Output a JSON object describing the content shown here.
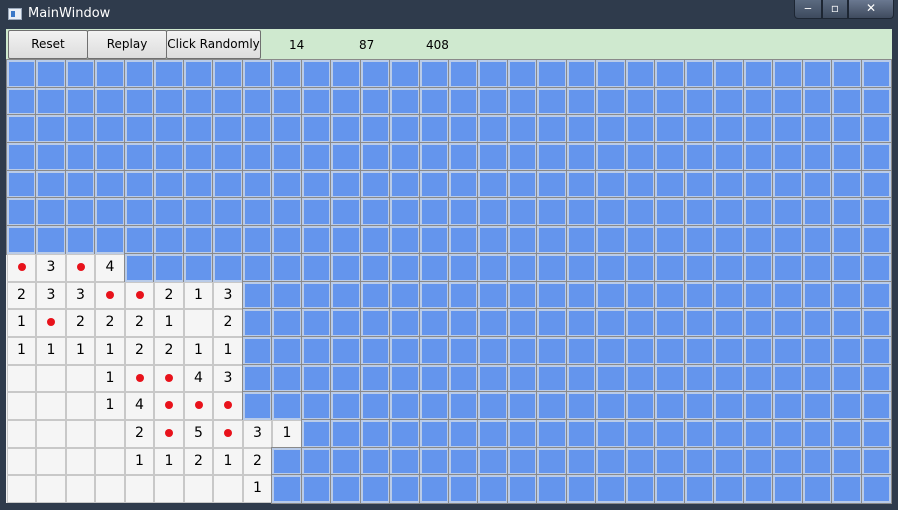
{
  "window": {
    "title": "MainWindow"
  },
  "toolbar": {
    "reset_label": "Reset",
    "replay_label": "Replay",
    "random_label": "Click Randomly"
  },
  "stats": {
    "a": "14",
    "b": "87",
    "c": "408"
  },
  "colors": {
    "hidden": "#6495ed",
    "mine": "#e8121b",
    "toolbar": "#cfe9cf"
  },
  "board": {
    "cols": 30,
    "rows": 16,
    "open_rows": {
      "7": [
        "*",
        "3",
        "*",
        "4"
      ],
      "8": [
        "2",
        "3",
        "3",
        "*",
        "*",
        "2",
        "1",
        "3"
      ],
      "9": [
        "1",
        "*",
        "2",
        "2",
        "2",
        "1",
        "",
        "2"
      ],
      "10": [
        "1",
        "1",
        "1",
        "1",
        "2",
        "2",
        "1",
        "1"
      ],
      "11": [
        "",
        "",
        "",
        "1",
        "*",
        "*",
        "4",
        "3"
      ],
      "12": [
        "",
        "",
        "",
        "1",
        "4",
        "*",
        "*",
        "*"
      ],
      "13": [
        "",
        "",
        "",
        "",
        "2",
        "*",
        "5",
        "*",
        "3",
        "1"
      ],
      "14": [
        "",
        "",
        "",
        "",
        "1",
        "1",
        "2",
        "1",
        "2"
      ],
      "15": [
        "",
        "",
        "",
        "",
        "",
        "",
        "",
        "",
        "1"
      ]
    }
  }
}
